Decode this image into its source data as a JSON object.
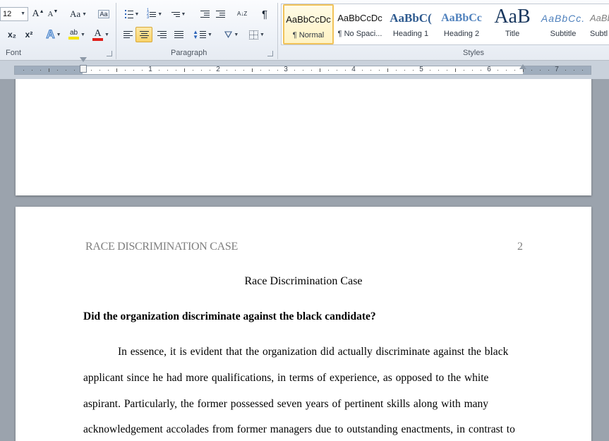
{
  "ribbon": {
    "font_group": {
      "label": "Font",
      "font_size": "12",
      "grow_font": "A",
      "shrink_font": "A",
      "change_case": "Aa",
      "subscript": "x₂",
      "superscript": "x²",
      "highlight_label": "ab",
      "font_color_label": "A",
      "highlight_color": "#f5e300",
      "font_color": "#e0201b"
    },
    "paragraph_group": {
      "label": "Paragraph",
      "show_marks": "¶",
      "sort": "A↓Z"
    },
    "styles_group": {
      "label": "Styles",
      "items": [
        {
          "sample": "AaBbCcDc",
          "name": "¶ Normal"
        },
        {
          "sample": "AaBbCcDc",
          "name": "¶ No Spaci..."
        },
        {
          "sample": "AaBbC(",
          "name": "Heading 1"
        },
        {
          "sample": "AaBbCc",
          "name": "Heading 2"
        },
        {
          "sample": "AaB",
          "name": "Title"
        },
        {
          "sample": "AaBbCc.",
          "name": "Subtitle"
        },
        {
          "sample": "AaBb",
          "name": "Subtl"
        }
      ],
      "selected_index": 0
    }
  },
  "ruler": {
    "numbers": [
      "1",
      "2",
      "3",
      "4",
      "5",
      "6",
      "7"
    ]
  },
  "document": {
    "running_header": "RACE DISCRIMINATION CASE",
    "page_number": "2",
    "title": "Race Discrimination Case",
    "heading": "Did the organization discriminate against the black candidate?",
    "paragraph_lines": [
      "In essence, it is evident that the organization did actually discriminate against the black",
      "applicant since he had more qualifications, in terms of experience, as opposed to the white",
      "aspirant. Particularly, the former possessed seven years of pertinent skills along with many",
      "acknowledgement accolades from former managers due to outstanding enactments, in contrast to"
    ]
  },
  "colors": {
    "ribbon_bg": "#eef2f8",
    "workspace_bg": "#9ba3ad",
    "selection_gold": "#f9d36a",
    "header_gray": "#7f7f7f"
  }
}
